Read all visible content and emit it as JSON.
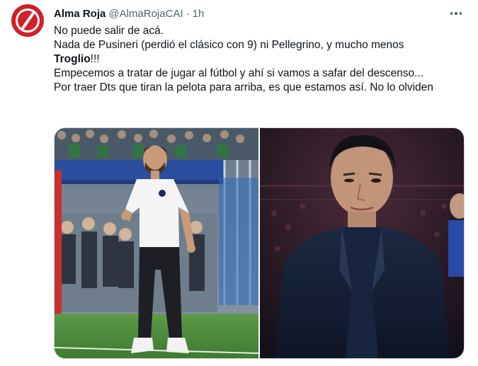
{
  "tweet": {
    "display_name": "Alma Roja",
    "handle": "@AlmaRojaCAI",
    "separator": "·",
    "time": "1h",
    "lines": [
      "No puede salir de acá.",
      "Nada de Pusineri (perdió el clásico con 9) ni Pellegrino, y mucho menos",
      "Empecemos a tratar de jugar al fútbol y ahí si vamos a safar del descenso...",
      "Por traer Dts que tiran la pelota para arriba, es que estamos así. No lo olviden"
    ],
    "bold_word": "Troglio",
    "bold_suffix": "!!!"
  },
  "colors": {
    "text": "#0f1419",
    "secondary": "#536471",
    "avatar": "#d31f26",
    "border": "#cfd9de"
  },
  "icons": {
    "more": "more-horizontal-icon",
    "avatar": "club-crest-avatar"
  }
}
